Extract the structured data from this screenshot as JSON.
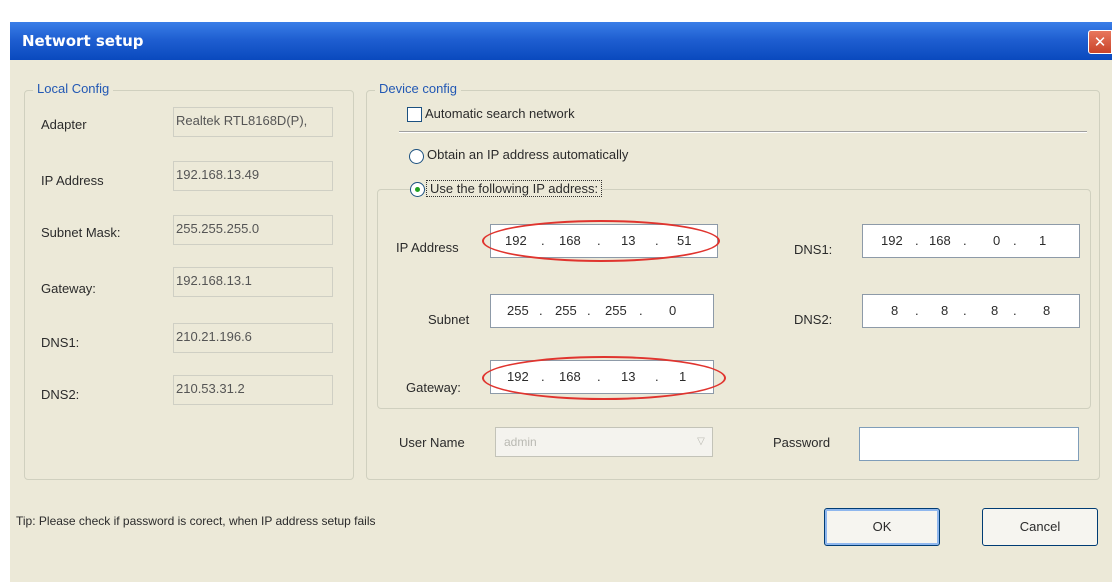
{
  "window": {
    "title": "Networt setup",
    "close_glyph": "✕"
  },
  "local_config": {
    "legend": "Local Config",
    "rows": [
      {
        "label": "Adapter",
        "value": "Realtek RTL8168D(P),"
      },
      {
        "label": "IP Address",
        "value": "192.168.13.49"
      },
      {
        "label": "Subnet Mask:",
        "value": "255.255.255.0"
      },
      {
        "label": "Gateway:",
        "value": "192.168.13.1"
      },
      {
        "label": "DNS1:",
        "value": "210.21.196.6"
      },
      {
        "label": "DNS2:",
        "value": "210.53.31.2"
      }
    ]
  },
  "device_config": {
    "legend": "Device config",
    "auto_search_label": "Automatic search network",
    "auto_search_checked": false,
    "obtain_auto_label": "Obtain an IP address automatically",
    "use_following_label": "Use the following IP address:",
    "selected_mode": "use_following",
    "ip_address": {
      "label": "IP Address",
      "octets": [
        "192",
        "168",
        "13",
        "51"
      ]
    },
    "subnet": {
      "label": "Subnet",
      "octets": [
        "255",
        "255",
        "255",
        "0"
      ]
    },
    "gateway": {
      "label": "Gateway:",
      "octets": [
        "192",
        "168",
        "13",
        "1"
      ]
    },
    "dns1": {
      "label": "DNS1:",
      "octets": [
        "192",
        "168",
        "0",
        "1"
      ]
    },
    "dns2": {
      "label": "DNS2:",
      "octets": [
        "8",
        "8",
        "8",
        "8"
      ]
    },
    "user_name": {
      "label": "User Name",
      "value": "admin",
      "disabled": true
    },
    "password": {
      "label": "Password",
      "value": ""
    }
  },
  "footer": {
    "tip": "Tip:  Please check if password is corect, when IP address setup fails",
    "ok_label": "OK",
    "cancel_label": "Cancel"
  },
  "colors": {
    "title_bar": "#1f5fd1",
    "legend_text": "#2258b4",
    "highlight_ring": "#e0342e",
    "radio_selected": "#21a121"
  }
}
